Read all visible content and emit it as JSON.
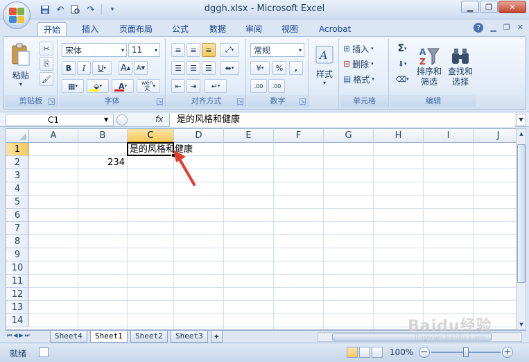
{
  "window": {
    "title": "dggh.xlsx - Microsoft Excel"
  },
  "ribbon_tabs": [
    "开始",
    "插入",
    "页面布局",
    "公式",
    "数据",
    "审阅",
    "视图",
    "Acrobat"
  ],
  "active_tab": "开始",
  "clipboard": {
    "paste_label": "粘贴",
    "group_label": "剪贴板"
  },
  "font": {
    "name": "宋体",
    "size": "11",
    "bold": "B",
    "italic": "I",
    "underline": "U",
    "group_label": "字体",
    "wen_label": "wén",
    "a_grow": "A",
    "a_shrink": "A",
    "font_color_letter": "A"
  },
  "alignment": {
    "group_label": "对齐方式"
  },
  "number": {
    "format": "常规",
    "percent": "%",
    "comma": ",",
    "inc_decimal": ".00",
    "dec_decimal": ".00",
    "group_label": "数字"
  },
  "styles": {
    "label": "样式"
  },
  "cells": {
    "insert": "插入",
    "delete": "删除",
    "format": "格式",
    "group_label": "单元格"
  },
  "editing": {
    "sort_filter": "排序和\n筛选",
    "find_select": "查找和\n选择",
    "group_label": "编辑",
    "sigma": "Σ"
  },
  "formula_bar": {
    "name_box": "C1",
    "fx": "fx",
    "content": "是的风格和健康"
  },
  "columns": [
    "A",
    "B",
    "C",
    "D",
    "E",
    "F",
    "G",
    "H",
    "I",
    "J"
  ],
  "rows": [
    "1",
    "2",
    "3",
    "4",
    "5",
    "6",
    "7",
    "8",
    "9",
    "10",
    "11",
    "12",
    "13",
    "14"
  ],
  "cells_data": {
    "C1": "是的风格和健康",
    "B2": "234"
  },
  "selected_cell": "C1",
  "sheet_tabs": [
    "Sheet4",
    "Sheet1",
    "Sheet2",
    "Sheet3"
  ],
  "active_sheet": "Sheet1",
  "status": {
    "ready": "就绪",
    "zoom": "100%",
    "zoom_minus": "−",
    "zoom_plus": "+"
  },
  "watermark": {
    "brand": "Baidu经验",
    "url": "jingyan.baidu.com"
  },
  "colors": {
    "selection_header": "#f6c85a",
    "arrow": "#e53b2a"
  }
}
